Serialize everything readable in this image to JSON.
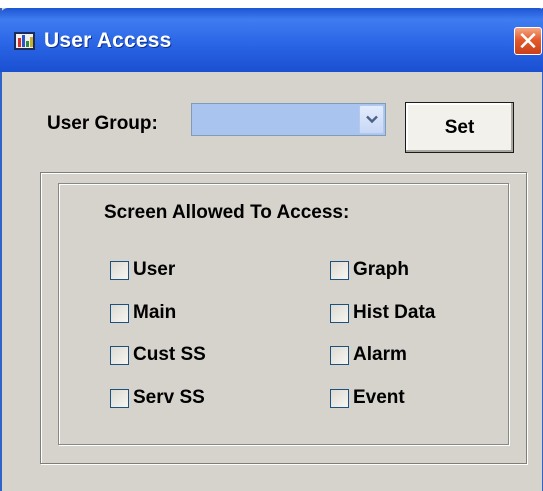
{
  "window": {
    "title": "User Access",
    "close_symbol": "✕"
  },
  "form": {
    "user_group_label": "User Group:",
    "user_group_value": "",
    "set_label": "Set"
  },
  "access": {
    "heading": "Screen Allowed To Access:",
    "left": [
      {
        "label": "User",
        "checked": false
      },
      {
        "label": "Main",
        "checked": false
      },
      {
        "label": "Cust SS",
        "checked": false
      },
      {
        "label": "Serv SS",
        "checked": false
      }
    ],
    "right": [
      {
        "label": "Graph",
        "checked": false
      },
      {
        "label": "Hist Data",
        "checked": false
      },
      {
        "label": "Alarm",
        "checked": false
      },
      {
        "label": "Event",
        "checked": false
      }
    ]
  },
  "colors": {
    "titlebar": "#2a66e6",
    "window_bg": "#d6d2cc",
    "combo_bg": "#a9c4ee",
    "close_button": "#e45a2c"
  },
  "icons": {
    "app": "chart-app-icon",
    "close": "close-icon",
    "dropdown": "chevron-down-icon"
  }
}
